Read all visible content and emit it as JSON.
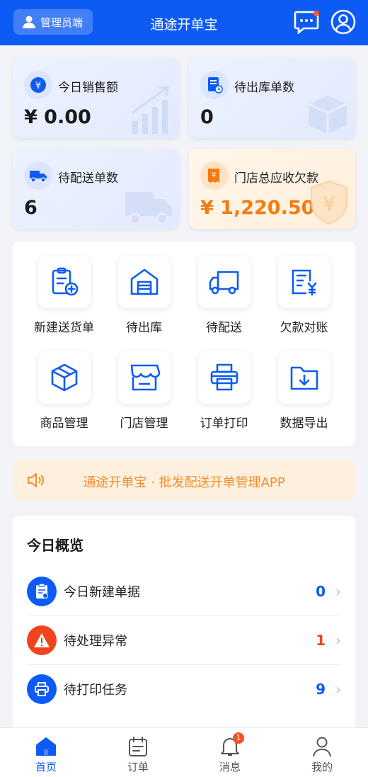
{
  "header": {
    "role_label": "管理员端",
    "title": "通途开单宝"
  },
  "stats": [
    {
      "label": "今日销售额",
      "value": "¥ 0.00"
    },
    {
      "label": "待出库单数",
      "value": "0"
    },
    {
      "label": "待配送单数",
      "value": "6"
    },
    {
      "label": "门店总应收欠款",
      "value": "¥ 1,220.50"
    }
  ],
  "grid": [
    {
      "label": "新建送货单",
      "icon": "new-order-icon"
    },
    {
      "label": "待出库",
      "icon": "warehouse-icon"
    },
    {
      "label": "待配送",
      "icon": "truck-icon"
    },
    {
      "label": "欠款对账",
      "icon": "bill-yen-icon"
    },
    {
      "label": "商品管理",
      "icon": "box-icon"
    },
    {
      "label": "门店管理",
      "icon": "store-icon"
    },
    {
      "label": "订单打印",
      "icon": "printer-icon"
    },
    {
      "label": "数据导出",
      "icon": "folder-download-icon"
    }
  ],
  "notice": {
    "text": "通途开单宝 · 批发配送开单管理APP"
  },
  "overview": {
    "title": "今日概览",
    "rows": [
      {
        "label": "今日新建单据",
        "value": "0",
        "color": "#0d5bf5"
      },
      {
        "label": "待处理异常",
        "value": "1",
        "color": "#f0441c"
      },
      {
        "label": "待打印任务",
        "value": "9",
        "color": "#0d5bf5"
      }
    ]
  },
  "tabs": [
    {
      "label": "首页",
      "active": true
    },
    {
      "label": "订单"
    },
    {
      "label": "消息",
      "badge": "1"
    },
    {
      "label": "我的"
    }
  ],
  "colors": {
    "primary": "#0d5bf5",
    "orange": "#f47b12",
    "red": "#f0441c"
  }
}
